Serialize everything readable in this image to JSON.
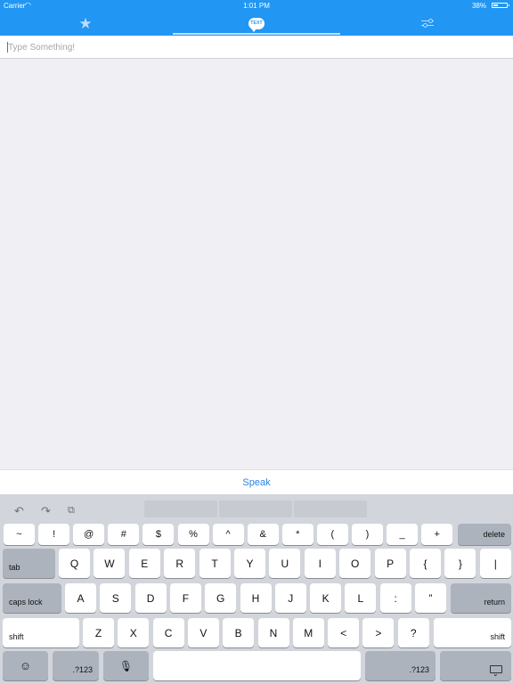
{
  "status": {
    "carrier": "Carrier",
    "time": "1:01 PM",
    "battery_pct": "38%",
    "battery_level": 0.38
  },
  "tabs": [
    {
      "icon": "star-icon",
      "selected": false
    },
    {
      "icon": "text-bubble-icon",
      "label": "TEXT",
      "selected": true
    },
    {
      "icon": "sliders-icon",
      "selected": false
    }
  ],
  "input": {
    "value": "",
    "placeholder": "Type Something!"
  },
  "speak_label": "Speak",
  "keyboard": {
    "toolbar": [
      "undo-icon",
      "redo-icon",
      "paste-icon"
    ],
    "row1": [
      "~",
      "!",
      "@",
      "#",
      "$",
      "%",
      "^",
      "&",
      "*",
      "(",
      ")",
      "_",
      "+"
    ],
    "delete_label": "delete",
    "tab_label": "tab",
    "row2": [
      "Q",
      "W",
      "E",
      "R",
      "T",
      "Y",
      "U",
      "I",
      "O",
      "P",
      "{",
      "}",
      "|"
    ],
    "caps_label": "caps lock",
    "row3": [
      "A",
      "S",
      "D",
      "F",
      "G",
      "H",
      "J",
      "K",
      "L",
      ":",
      "”"
    ],
    "return_label": "return",
    "shift_label": "shift",
    "row4": [
      "Z",
      "X",
      "C",
      "V",
      "B",
      "N",
      "M",
      "<",
      ">",
      "?"
    ],
    "num_label": ".?123",
    "emoji_icon": "emoji-icon",
    "mic_icon": "microphone-icon",
    "hide_icon": "hide-keyboard-icon"
  },
  "colors": {
    "accent": "#2196f3",
    "speak": "#2a82e4"
  }
}
